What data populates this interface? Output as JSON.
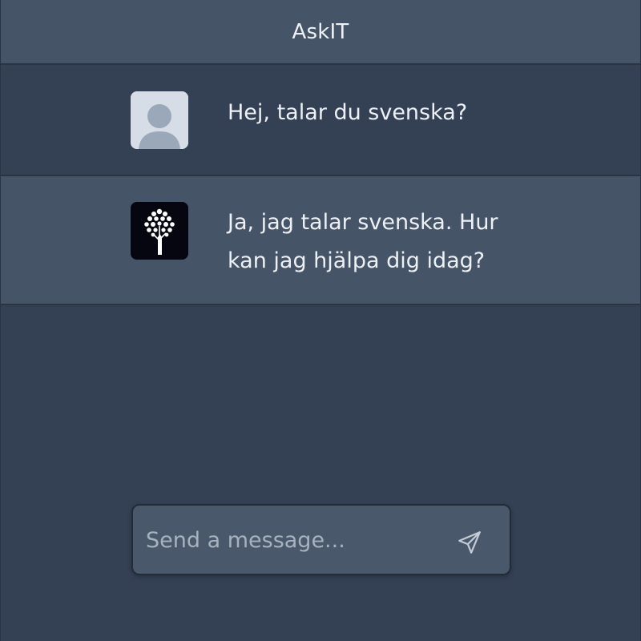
{
  "header": {
    "title": "AskIT"
  },
  "messages": [
    {
      "role": "user",
      "avatar_icon": "user-avatar-icon",
      "text": "Hej, talar du svenska?"
    },
    {
      "role": "assistant",
      "avatar_icon": "tree-logo-icon",
      "text": "Ja, jag talar svenska. Hur kan jag hjälpa dig idag?"
    }
  ],
  "composer": {
    "placeholder": "Send a message...",
    "value": "",
    "send_icon": "send-icon"
  },
  "colors": {
    "background": "#344154",
    "header_bg": "#465467",
    "assistant_row_bg": "#465467",
    "composer_bg": "#4a586b",
    "text": "#edf1f5",
    "placeholder": "#a7b2bf"
  }
}
